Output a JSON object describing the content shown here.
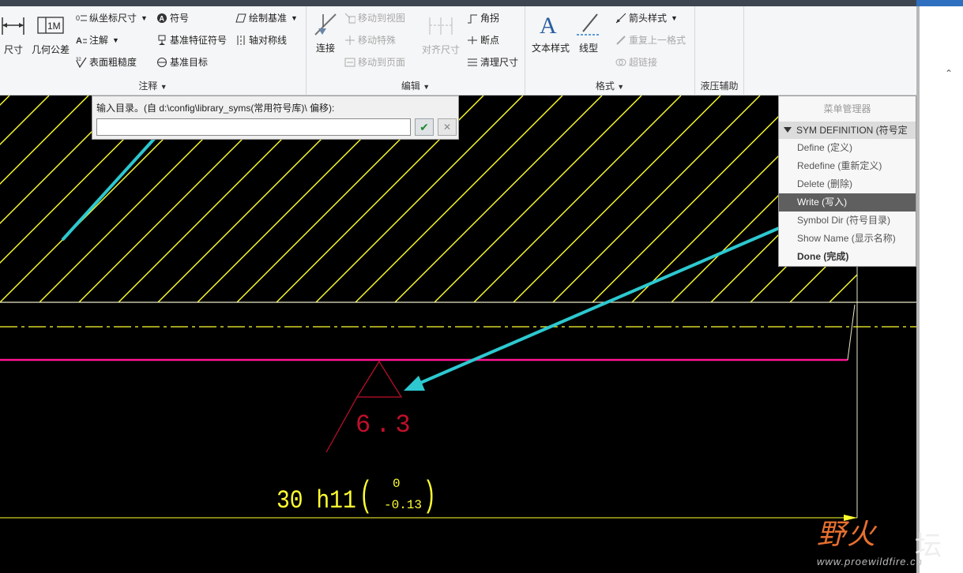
{
  "ribbon": {
    "annotation_group": {
      "label": "注释",
      "dimension": "尺寸",
      "geometric_tolerance": "几何公差",
      "ordinate_dimension": "纵坐标尺寸",
      "note": "注解",
      "surface_finish": "表面粗糙度",
      "symbol": "符号",
      "datum_feature_symbol": "基准特征符号",
      "datum_target": "基准目标",
      "sketched_datum": "绘制基准",
      "axis_of_symmetry": "轴对称线"
    },
    "edit_group": {
      "label": "编辑",
      "connect": "连接",
      "move_to_view": "移动到视图",
      "move_special": "移动特殊",
      "move_to_page": "移动到页面",
      "align_dimensions": "对齐尺寸",
      "jog": "角拐",
      "breakpoint": "断点",
      "clean_dimensions": "清理尺寸"
    },
    "format_group": {
      "label": "格式",
      "text_style": "文本样式",
      "line_style": "线型",
      "arrow_style": "箭头样式",
      "repeat_last_format": "重复上一格式",
      "hyperlink": "超链接"
    },
    "hydraulic_group": {
      "label": "液压辅助"
    },
    "big_icon_im": "1M"
  },
  "dialog": {
    "prompt": "输入目录。(自 d:\\config\\library_syms(常用符号库)\\ 偏移):",
    "input_value": "",
    "ok_icon": "checkmark-icon",
    "cancel_icon": "close-icon"
  },
  "menu_manager": {
    "title": "菜单管理器",
    "header": "SYM DEFINITION (符号定",
    "items": [
      {
        "label": "Define (定义)",
        "selected": false
      },
      {
        "label": "Redefine (重新定义)",
        "selected": false
      },
      {
        "label": "Delete (删除)",
        "selected": false
      },
      {
        "label": "Write (写入)",
        "selected": true
      },
      {
        "label": "Symbol Dir (符号目录)",
        "selected": false
      },
      {
        "label": "Show Name (显示名称)",
        "selected": false
      },
      {
        "label": "Done (完成)",
        "selected": false
      }
    ]
  },
  "drawing": {
    "roughness_value": "6.3",
    "dimension_text": "30 h11",
    "tolerance_upper": "0",
    "tolerance_lower": "-0.13"
  },
  "watermark": {
    "brand_left": "野火",
    "brand_right": "坛",
    "url": "www.proewildfire.cn"
  },
  "colors": {
    "hatch": "#ffff30",
    "centerline": "#ffff30",
    "edge": "#e8e8c8",
    "magenta_line": "#ff1493",
    "symbol": "#c0102a",
    "dimension": "#ffff30",
    "annotation_arrow": "#2dc8d0"
  }
}
